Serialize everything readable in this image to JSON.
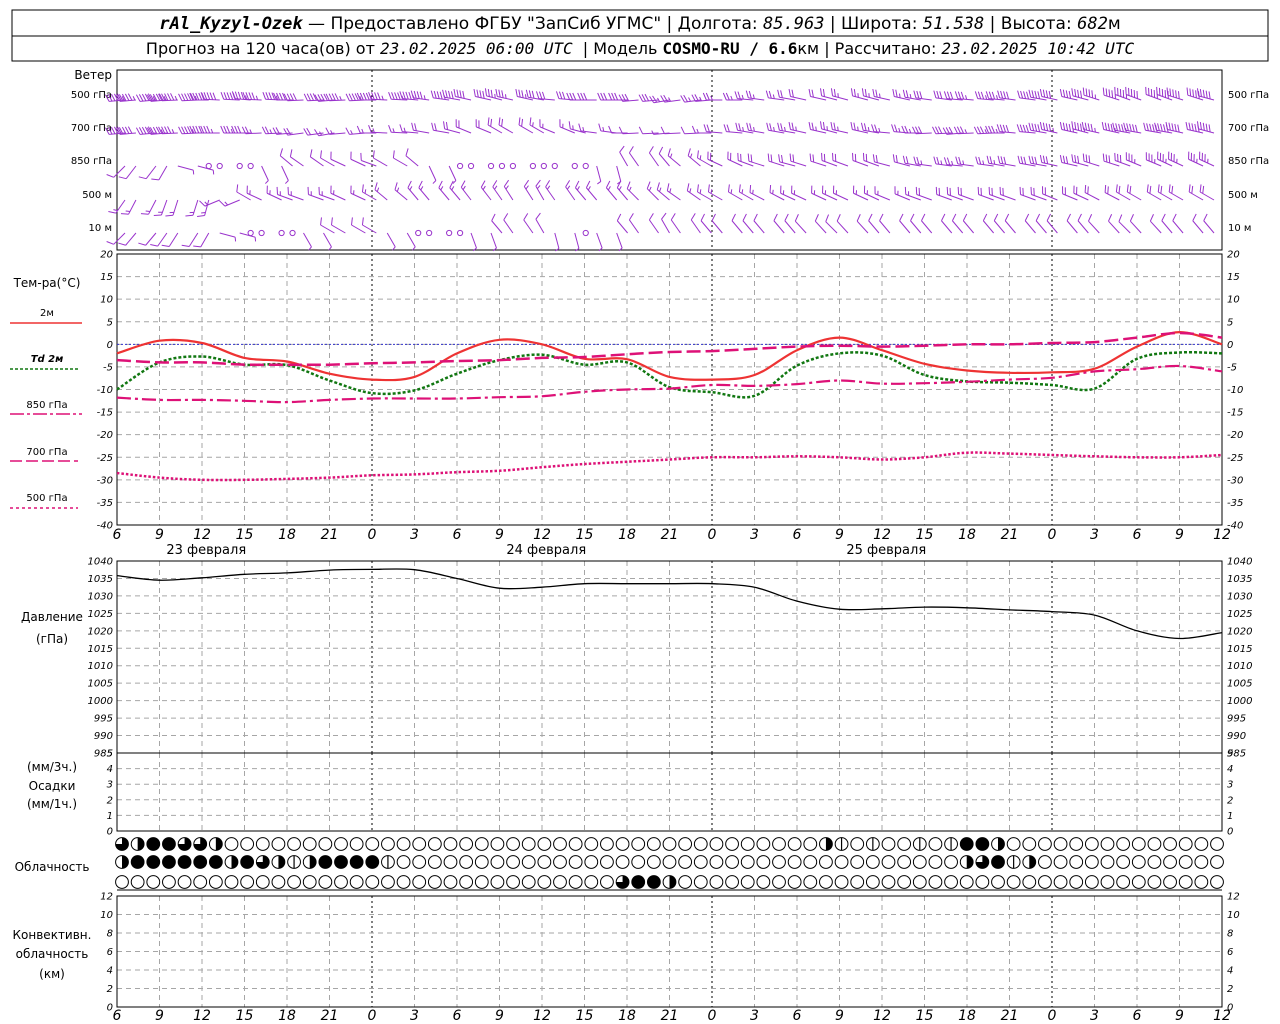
{
  "header": {
    "line1": {
      "station": "rAl_Kyzyl-Ozek",
      "provider": " — Предоставлено ФГБУ \"ЗапСиб УГМС\" | Долгота: ",
      "lon": "85.963",
      "lat_label": " | Широта: ",
      "lat": "51.538",
      "alt_label": " | Высота: ",
      "alt": "682",
      "alt_unit": "м"
    },
    "line2": {
      "prefix": "Прогноз на 120 часа(ов) от ",
      "start": "23.02.2025 06:00 UTC",
      "model_label": "  | Модель ",
      "model": "COSMO-RU / 6.6",
      "model_unit": "км",
      "calc_label": " | Рассчитано: ",
      "calc": "23.02.2025 10:42 UTC"
    }
  },
  "labels": {
    "wind_title": "Ветер",
    "wind_levels": [
      "500 гПа",
      "700 гПа",
      "850 гПа",
      "500 м",
      "10 м"
    ],
    "temp_title": "Тем-ра(°C)",
    "legend": [
      {
        "text": "2м",
        "color": "#ee3333",
        "style": "solid"
      },
      {
        "text": "Td  2м",
        "color": "#117711",
        "style": "dotted"
      },
      {
        "text": "850 гПа",
        "color": "#dd1177",
        "style": "dashdot"
      },
      {
        "text": "700 гПа",
        "color": "#dd1177",
        "style": "dash"
      },
      {
        "text": "500 гПа",
        "color": "#dd1177",
        "style": "dot"
      }
    ],
    "pressure_title": "Давление",
    "pressure_unit": "(гПа)",
    "precip_unit_3h": "(мм/3ч.)",
    "precip_title": "Осадки",
    "precip_unit_1h": "(мм/1ч.)",
    "cloud_title": "Облачность",
    "conv_title": "Конвективн.",
    "conv_title2": "облачность",
    "conv_unit": "(км)"
  },
  "time_axis": {
    "ticks": [
      "6",
      "9",
      "12",
      "15",
      "18",
      "21",
      "0",
      "3",
      "6",
      "9",
      "12",
      "15",
      "18",
      "21",
      "0",
      "3",
      "6",
      "9",
      "12",
      "15",
      "18",
      "21",
      "0",
      "3",
      "6",
      "9",
      "12"
    ],
    "days": [
      {
        "text": "23 февраля",
        "col": 2
      },
      {
        "text": "24 февраля",
        "col": 10
      },
      {
        "text": "25 февраля",
        "col": 18
      }
    ],
    "midnights": [
      6,
      14,
      22
    ]
  },
  "colors": {
    "wind": "#9933cc",
    "t2m": "#ee3333",
    "td2m": "#117711",
    "upper": "#dd1177",
    "zero": "#3333cc"
  },
  "chart_data": [
    {
      "type": "line",
      "name": "temperature",
      "ylabel": "Тем-ра(°C)",
      "ylim": [
        -40,
        20
      ],
      "yticks": [
        20,
        15,
        10,
        5,
        0,
        -5,
        -10,
        -15,
        -20,
        -25,
        -30,
        -35,
        -40
      ],
      "x": [
        6,
        9,
        12,
        15,
        18,
        21,
        24,
        27,
        30,
        33,
        36,
        39,
        42,
        45,
        48,
        51,
        54,
        57,
        60,
        63,
        66,
        69,
        72,
        75,
        78,
        81,
        84
      ],
      "series": [
        {
          "name": "2м",
          "values": [
            -2,
            0.8,
            0.3,
            -3,
            -3.8,
            -6.5,
            -7.8,
            -7.2,
            -2,
            1,
            0,
            -3.2,
            -3.3,
            -7.2,
            -7.8,
            -6.8,
            -1.3,
            1.5,
            -1.3,
            -4.3,
            -5.8,
            -6.3,
            -6.2,
            -5.4,
            -0.5,
            2.7,
            0
          ]
        },
        {
          "name": "Td  2м",
          "values": [
            -10,
            -4,
            -2.7,
            -4.5,
            -4.6,
            -8,
            -10.8,
            -10.2,
            -6.5,
            -3.5,
            -2.3,
            -4.5,
            -4,
            -9.5,
            -10.6,
            -11.4,
            -4.7,
            -2,
            -2.5,
            -6.8,
            -8.2,
            -8.5,
            -9,
            -9.8,
            -3.2,
            -1.8,
            -2
          ]
        },
        {
          "name": "850 гПа",
          "values": [
            -11.8,
            -12.3,
            -12.3,
            -12.5,
            -12.8,
            -12.3,
            -12,
            -12,
            -12,
            -11.7,
            -11.5,
            -10.5,
            -10,
            -9.8,
            -9,
            -9.2,
            -8.8,
            -8,
            -8.7,
            -8.6,
            -8.3,
            -7.8,
            -7.4,
            -6,
            -5.5,
            -4.8,
            -6
          ]
        },
        {
          "name": "700 гПа",
          "values": [
            -3.5,
            -4,
            -4,
            -4.5,
            -4.5,
            -4.5,
            -4.2,
            -4,
            -3.7,
            -3.5,
            -3,
            -2.8,
            -2.2,
            -1.7,
            -1.5,
            -1,
            -0.5,
            -0.3,
            -0.5,
            -0.3,
            0,
            0,
            0.3,
            0.5,
            1.5,
            2.5,
            1.5
          ]
        },
        {
          "name": "500 гПа",
          "values": [
            -28.5,
            -29.5,
            -30,
            -30,
            -29.8,
            -29.5,
            -29,
            -28.8,
            -28.3,
            -28,
            -27.2,
            -26.5,
            -26,
            -25.5,
            -25,
            -25,
            -24.8,
            -25,
            -25.5,
            -25,
            -24,
            -24.2,
            -24.5,
            -24.8,
            -25,
            -25,
            -24.5
          ]
        }
      ]
    },
    {
      "type": "line",
      "name": "pressure",
      "ylabel": "Давление",
      "ylim": [
        985,
        1040
      ],
      "yticks": [
        1040,
        1035,
        1030,
        1025,
        1020,
        1015,
        1010,
        1005,
        1000,
        995,
        990,
        985
      ],
      "x": [
        6,
        9,
        12,
        15,
        18,
        21,
        24,
        27,
        30,
        33,
        36,
        39,
        42,
        45,
        48,
        51,
        54,
        57,
        60,
        63,
        66,
        69,
        72,
        75,
        78,
        81,
        84
      ],
      "series": [
        {
          "name": "",
          "values": [
            1035.8,
            1034.5,
            1035.2,
            1036.2,
            1036.6,
            1037.4,
            1037.6,
            1037.5,
            1035,
            1032.2,
            1032.5,
            1033.5,
            1033.5,
            1033.5,
            1033.5,
            1032.5,
            1028.5,
            1026.2,
            1026.3,
            1026.8,
            1026.6,
            1026,
            1025.5,
            1024.5,
            1020,
            1017.8,
            1019.5
          ]
        }
      ]
    },
    {
      "type": "bar",
      "name": "precipitation",
      "ylim": [
        0,
        5
      ],
      "yticks": [
        5,
        4,
        3,
        2,
        1,
        0
      ],
      "values": []
    },
    {
      "type": "bar",
      "name": "convective_cloud",
      "ylim": [
        0,
        12
      ],
      "yticks": [
        12,
        10,
        8,
        6,
        4,
        2,
        0
      ],
      "values": []
    }
  ],
  "wind_rows": [
    {
      "dir": [
        265,
        265,
        270,
        275,
        270,
        265,
        270,
        275,
        280,
        285,
        280,
        270,
        270,
        260,
        265,
        275,
        280,
        285,
        285,
        280,
        275,
        275,
        280,
        285,
        290,
        290,
        285
      ],
      "spd": [
        55,
        55,
        50,
        45,
        40,
        40,
        45,
        45,
        40,
        35,
        30,
        30,
        30,
        25,
        25,
        25,
        20,
        20,
        25,
        25,
        30,
        35,
        40,
        40,
        45,
        50,
        50
      ]
    },
    {
      "dir": [
        265,
        265,
        270,
        270,
        265,
        260,
        270,
        275,
        285,
        300,
        300,
        285,
        270,
        265,
        270,
        280,
        280,
        285,
        280,
        270,
        265,
        270,
        280,
        285,
        280,
        280,
        285
      ],
      "spd": [
        50,
        45,
        40,
        30,
        20,
        15,
        15,
        15,
        20,
        20,
        15,
        15,
        10,
        5,
        15,
        25,
        25,
        25,
        25,
        25,
        30,
        35,
        40,
        45,
        45,
        50,
        50
      ]
    },
    {
      "dir": [
        225,
        210,
        0,
        0,
        310,
        300,
        290,
        310,
        0,
        0,
        0,
        0,
        330,
        320,
        300,
        290,
        285,
        290,
        290,
        280,
        275,
        280,
        280,
        285,
        290,
        295,
        295
      ],
      "spd": [
        10,
        10,
        0,
        0,
        10,
        10,
        10,
        10,
        0,
        0,
        0,
        0,
        10,
        10,
        15,
        20,
        20,
        20,
        20,
        20,
        25,
        25,
        30,
        30,
        30,
        35,
        35
      ]
    },
    {
      "dir": [
        215,
        200,
        195,
        300,
        290,
        290,
        300,
        320,
        320,
        325,
        330,
        320,
        320,
        310,
        300,
        300,
        295,
        295,
        295,
        290,
        290,
        290,
        290,
        295,
        300,
        300,
        300
      ],
      "spd": [
        15,
        15,
        15,
        10,
        15,
        15,
        15,
        15,
        15,
        15,
        15,
        15,
        15,
        15,
        15,
        15,
        15,
        15,
        15,
        15,
        20,
        20,
        20,
        20,
        20,
        20,
        20
      ]
    },
    {
      "dir": [
        225,
        215,
        210,
        0,
        0,
        300,
        300,
        0,
        0,
        320,
        330,
        0,
        320,
        330,
        320,
        320,
        320,
        315,
        320,
        320,
        320,
        320,
        320,
        320,
        315,
        320,
        320
      ],
      "spd": [
        10,
        10,
        10,
        0,
        0,
        10,
        10,
        0,
        0,
        10,
        10,
        0,
        10,
        10,
        10,
        10,
        10,
        10,
        10,
        10,
        10,
        10,
        10,
        10,
        10,
        10,
        10
      ]
    }
  ],
  "cloud_rows": [
    [
      3,
      2,
      4,
      4,
      3,
      3,
      2,
      0,
      0,
      0,
      0,
      0,
      0,
      0,
      0,
      0,
      0,
      0,
      0,
      0,
      0,
      0,
      0,
      0,
      0,
      0,
      0,
      0,
      0,
      0,
      0,
      0,
      0,
      0,
      0,
      0,
      0,
      0,
      0,
      0,
      0,
      0,
      0,
      0,
      0,
      2,
      1,
      0,
      1,
      0,
      0,
      1,
      0,
      1,
      4,
      4,
      2,
      0,
      0,
      0,
      0,
      0,
      0,
      0,
      0,
      0,
      0,
      0,
      0,
      0,
      0
    ],
    [
      2,
      4,
      4,
      4,
      4,
      4,
      4,
      2,
      4,
      3,
      2,
      1,
      2,
      4,
      4,
      4,
      4,
      1,
      0,
      0,
      0,
      0,
      0,
      0,
      0,
      0,
      0,
      0,
      0,
      0,
      0,
      0,
      0,
      0,
      0,
      0,
      0,
      0,
      0,
      0,
      0,
      0,
      0,
      0,
      0,
      0,
      0,
      0,
      0,
      0,
      0,
      0,
      0,
      0,
      2,
      3,
      4,
      1,
      2,
      0,
      0,
      0,
      0,
      0,
      0,
      0,
      0,
      0,
      0,
      0,
      0
    ],
    [
      0,
      0,
      0,
      0,
      0,
      0,
      0,
      0,
      0,
      0,
      0,
      0,
      0,
      0,
      0,
      0,
      0,
      0,
      0,
      0,
      0,
      0,
      0,
      0,
      0,
      0,
      0,
      0,
      0,
      0,
      0,
      0,
      3,
      4,
      4,
      2,
      0,
      0,
      0,
      0,
      0,
      0,
      0,
      0,
      0,
      0,
      0,
      0,
      0,
      0,
      0,
      0,
      0,
      0,
      0,
      0,
      0,
      0,
      0,
      0,
      0,
      0,
      0,
      0,
      0,
      0,
      0,
      0,
      0,
      0,
      0
    ]
  ]
}
